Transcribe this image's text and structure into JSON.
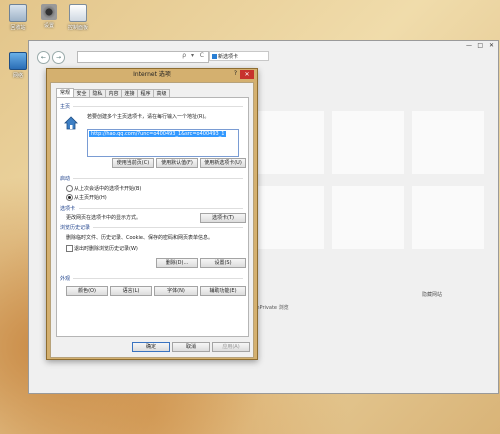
{
  "desktop": {
    "icons": [
      {
        "label": "回收站",
        "icon": "recycle-bin-icon"
      },
      {
        "label": "设置",
        "icon": "gear-icon"
      },
      {
        "label": "控制面板",
        "icon": "control-panel-icon"
      },
      {
        "label": "网络",
        "icon": "network-icon"
      }
    ]
  },
  "browser": {
    "search_glyph": "ρ",
    "dropdown_glyph": "▾",
    "refresh_glyph": "C",
    "back_glyph": "←",
    "forward_glyph": "→",
    "tab_label": "新选项卡",
    "window_minimize": "—",
    "window_maximize": "□",
    "window_close": "✕",
    "new_tab_text_left": "隐藏网站",
    "new_tab_text_right": "inPrivate 浏览"
  },
  "dialog": {
    "title": "Internet 选项",
    "help_glyph": "?",
    "close_glyph": "✕",
    "tabs": [
      "常规",
      "安全",
      "隐私",
      "内容",
      "连接",
      "程序",
      "高级"
    ],
    "home": {
      "label": "主页",
      "description": "若要创建多个主页选项卡，请在每行输入一个地址(R)。",
      "url": "http://hao.qq.com/?unc=o400493_1&src=o400493_1",
      "btn_current": "使用当前页(C)",
      "btn_default": "使用默认值(F)",
      "btn_newtab": "使用新选项卡(U)"
    },
    "startup": {
      "label": "启动",
      "option_last": "从上次会话中的选项卡开始(B)",
      "option_home": "从主页开始(H)"
    },
    "tabs_section": {
      "label": "选项卡",
      "description": "更改网页在选项卡中的显示方式。",
      "button": "选项卡(T)"
    },
    "history": {
      "label": "浏览历史记录",
      "description": "删除临时文件、历史记录、Cookie、保存的密码和网页表单信息。",
      "checkbox": "退出时删除浏览历史记录(W)",
      "btn_delete": "删除(D)...",
      "btn_settings": "设置(S)"
    },
    "appearance": {
      "label": "外观",
      "btn_colors": "颜色(O)",
      "btn_languages": "语言(L)",
      "btn_fonts": "字体(N)",
      "btn_accessibility": "辅助功能(E)"
    },
    "footer": {
      "ok": "确定",
      "cancel": "取消",
      "apply": "应用(A)"
    }
  },
  "colors": {
    "dialog_frame": "#d4b06f",
    "close_red": "#c7322c",
    "selection_blue": "#3399ff",
    "section_label": "#1b3f8a"
  }
}
